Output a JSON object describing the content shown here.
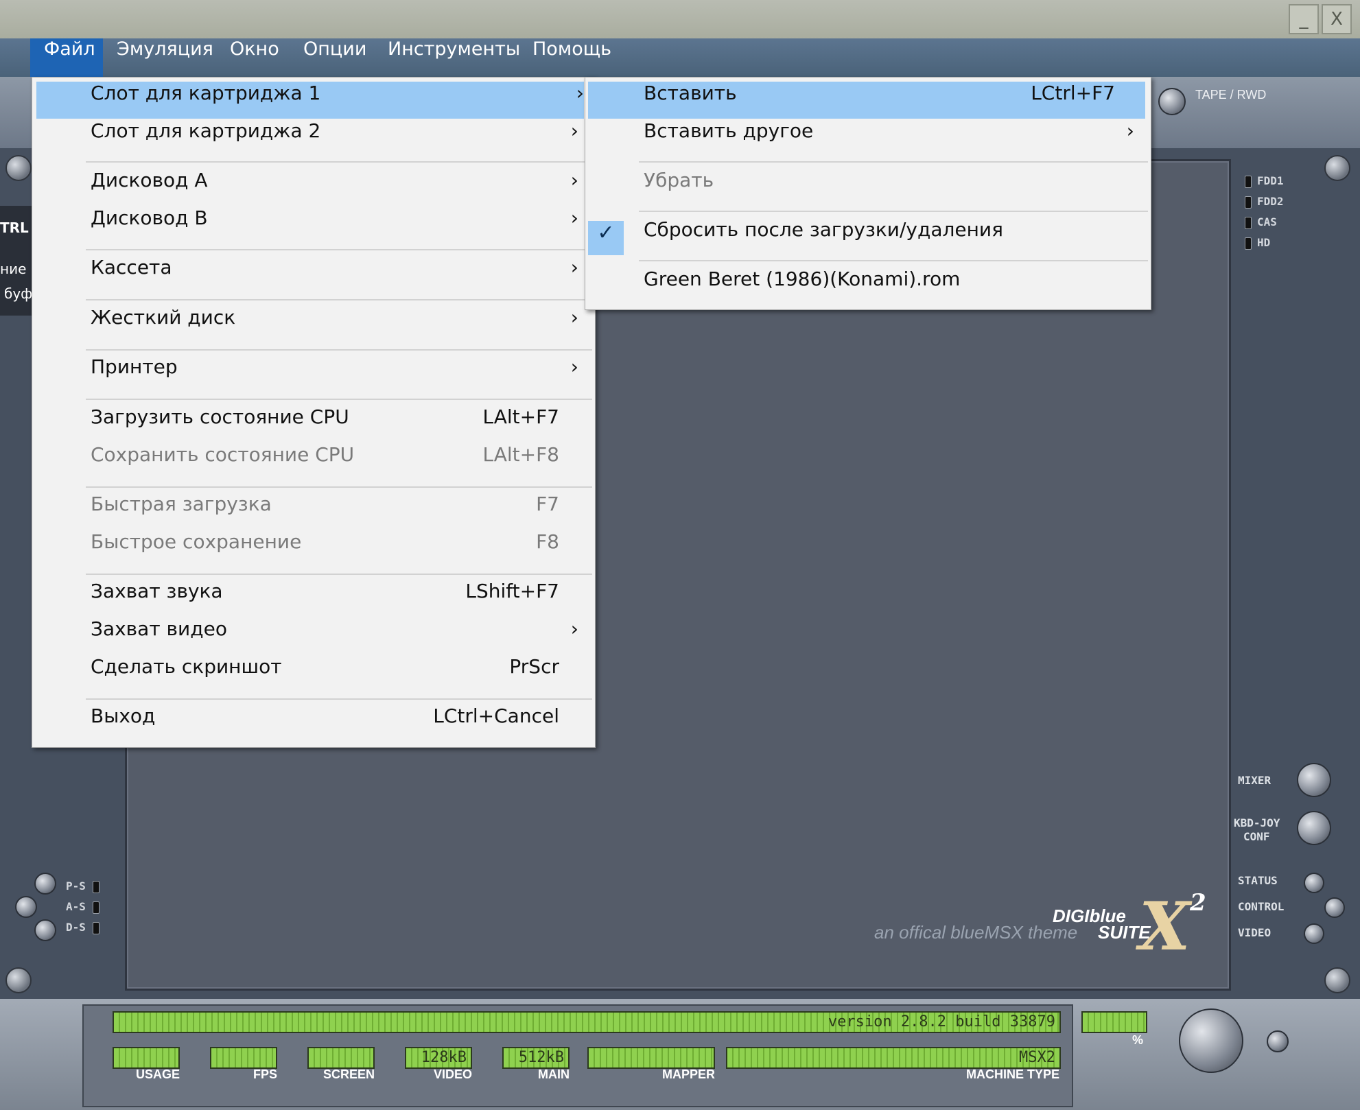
{
  "menubar": {
    "items": [
      "Файл",
      "Эмуляция",
      "Окно",
      "Опции",
      "Инструменты",
      "Помощь"
    ]
  },
  "window_controls": {
    "minimize": "_",
    "close": "X"
  },
  "file_menu": {
    "items": [
      {
        "label": "Слот для картриджа 1",
        "shortcut": "",
        "submenu": true,
        "state": "highlighted"
      },
      {
        "label": "Слот для картриджа 2",
        "shortcut": "",
        "submenu": true
      },
      {
        "label": "Дисковод A",
        "shortcut": "",
        "submenu": true
      },
      {
        "label": "Дисковод B",
        "shortcut": "",
        "submenu": true
      },
      {
        "label": "Кассета",
        "shortcut": "",
        "submenu": true
      },
      {
        "label": "Жесткий диск",
        "shortcut": "",
        "submenu": true
      },
      {
        "label": "Принтер",
        "shortcut": "",
        "submenu": true
      },
      {
        "label": "Загрузить состояние CPU",
        "shortcut": "LAlt+F7"
      },
      {
        "label": "Сохранить состояние CPU",
        "shortcut": "LAlt+F8",
        "state": "disabled"
      },
      {
        "label": "Быстрая загрузка",
        "shortcut": "F7",
        "state": "disabled"
      },
      {
        "label": "Быстрое сохранение",
        "shortcut": "F8",
        "state": "disabled"
      },
      {
        "label": "Захват звука",
        "shortcut": "LShift+F7"
      },
      {
        "label": "Захват видео",
        "shortcut": "",
        "submenu": true
      },
      {
        "label": "Сделать скриншот",
        "shortcut": "PrScr"
      },
      {
        "label": "Выход",
        "shortcut": "LCtrl+Cancel"
      }
    ]
  },
  "cartridge_submenu": {
    "items": [
      {
        "label": "Вставить",
        "shortcut": "LCtrl+F7",
        "state": "highlighted"
      },
      {
        "label": "Вставить другое",
        "shortcut": "",
        "submenu": true
      },
      {
        "label": "Убрать",
        "shortcut": "",
        "state": "disabled"
      },
      {
        "label": "Сбросить после загрузки/удаления",
        "shortcut": "",
        "checked": true
      },
      {
        "label": "Green Beret (1986)(Konami).rom",
        "shortcut": ""
      }
    ]
  },
  "arrow_glyph": "›",
  "check_glyph": "✓",
  "left_stub": {
    "line1": "TRL",
    "line2": "ние",
    "line3": "буф"
  },
  "tape_label": "TAPE / RWD",
  "drive_leds": [
    "FDD1",
    "FDD2",
    "CAS",
    "HD"
  ],
  "port_leds": [
    "P-S",
    "A-S",
    "D-S"
  ],
  "right_controls": {
    "mixer": "MIXER",
    "kbd_joy_line1": "KBD-JOY",
    "kbd_joy_line2": "CONF",
    "status": "STATUS",
    "control": "CONTROL",
    "video": "VIDEO"
  },
  "branding": {
    "line1": "DIGIblue",
    "line2": "an offical blueMSX theme",
    "line3": "SUITE",
    "mark": "X",
    "sup": "2"
  },
  "status_panel": {
    "version": "version 2.8.2  build 33879",
    "percent_label": "%",
    "meters": [
      {
        "label": "USAGE",
        "value": ""
      },
      {
        "label": "FPS",
        "value": ""
      },
      {
        "label": "SCREEN",
        "value": ""
      },
      {
        "label": "VIDEO",
        "value": "128kB"
      },
      {
        "label": "MAIN",
        "value": "512kB"
      },
      {
        "label": "MAPPER",
        "value": ""
      },
      {
        "label": "MACHINE TYPE",
        "value": "MSX2"
      }
    ]
  }
}
